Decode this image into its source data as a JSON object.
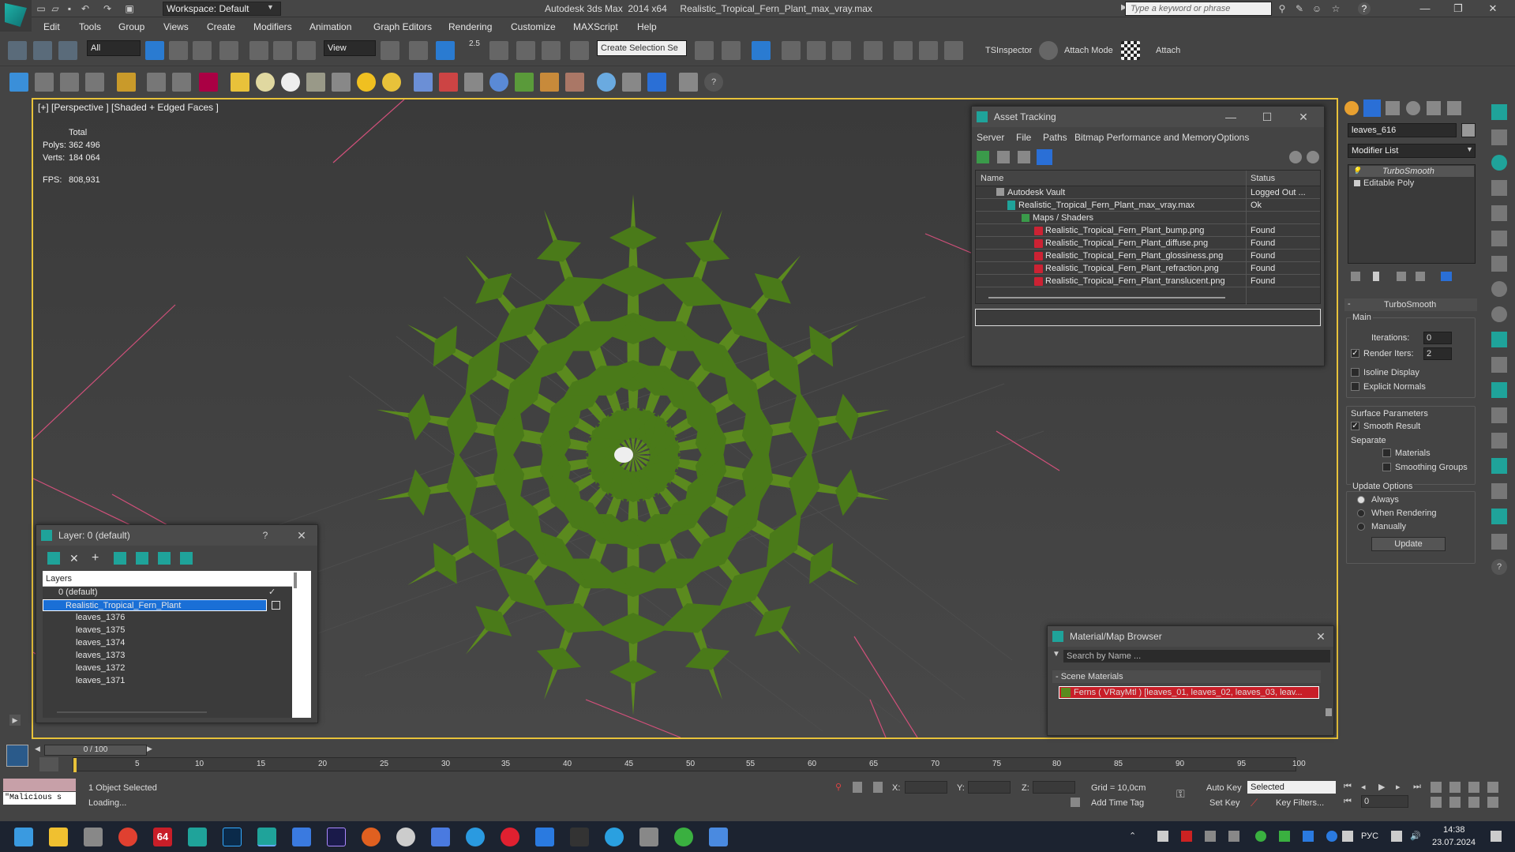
{
  "titlebar": {
    "workspace": "Workspace: Default",
    "title": "Autodesk 3ds Max  2014 x64     Realistic_Tropical_Fern_Plant_max_vray.max",
    "search_placeholder": "Type a keyword or phrase"
  },
  "menubar": [
    "Edit",
    "Tools",
    "Group",
    "Views",
    "Create",
    "Modifiers",
    "Animation",
    "Graph Editors",
    "Rendering",
    "Customize",
    "MAXScript",
    "Help"
  ],
  "toolbar": {
    "selection_filter": "All",
    "ref_coord": "View",
    "snap_value": "2.5",
    "named_selection": "Create Selection Se",
    "tsinspector": "TSInspector",
    "attach_mode": "Attach Mode",
    "attach": "Attach"
  },
  "viewport": {
    "label": "[+] [Perspective ] [Shaded + Edged Faces ]",
    "stats_header": "Total",
    "polys_label": "Polys:",
    "polys_value": "362 496",
    "verts_label": "Verts:",
    "verts_value": "184 064",
    "fps_label": "FPS:",
    "fps_value": "808,931"
  },
  "asset_tracking": {
    "title": "Asset Tracking",
    "menu": [
      "Server",
      "File",
      "Paths",
      "Bitmap Performance and Memory",
      "Options"
    ],
    "col_name": "Name",
    "col_status": "Status",
    "rows": [
      {
        "name": "Autodesk Vault",
        "status": "Logged Out ..."
      },
      {
        "name": "Realistic_Tropical_Fern_Plant_max_vray.max",
        "status": "Ok"
      },
      {
        "name": "Maps / Shaders",
        "status": ""
      },
      {
        "name": "Realistic_Tropical_Fern_Plant_bump.png",
        "status": "Found"
      },
      {
        "name": "Realistic_Tropical_Fern_Plant_diffuse.png",
        "status": "Found"
      },
      {
        "name": "Realistic_Tropical_Fern_Plant_glossiness.png",
        "status": "Found"
      },
      {
        "name": "Realistic_Tropical_Fern_Plant_refraction.png",
        "status": "Found"
      },
      {
        "name": "Realistic_Tropical_Fern_Plant_translucent.png",
        "status": "Found"
      }
    ]
  },
  "command_panel": {
    "object_name": "leaves_616",
    "modifier_list": "Modifier List",
    "stack": [
      "TurboSmooth",
      "Editable Poly"
    ],
    "rollout_title": "TurboSmooth",
    "main_label": "Main",
    "iterations_label": "Iterations:",
    "iterations_value": "0",
    "render_iters_label": "Render Iters:",
    "render_iters_value": "2",
    "isoline": "Isoline Display",
    "explicit_normals": "Explicit Normals",
    "surface_params": "Surface Parameters",
    "smooth_result": "Smooth Result",
    "separate": "Separate",
    "materials": "Materials",
    "smoothing_groups": "Smoothing Groups",
    "update_options": "Update Options",
    "always": "Always",
    "when_rendering": "When Rendering",
    "manually": "Manually",
    "update_btn": "Update"
  },
  "layer_panel": {
    "title": "Layer: 0 (default)",
    "help": "?",
    "header": "Layers",
    "rows": [
      "0 (default)",
      "Realistic_Tropical_Fern_Plant",
      "leaves_1376",
      "leaves_1375",
      "leaves_1374",
      "leaves_1373",
      "leaves_1372",
      "leaves_1371"
    ]
  },
  "material_browser": {
    "title": "Material/Map Browser",
    "search_placeholder": "Search by Name ...",
    "section": "- Scene Materials",
    "item": "Ferns  ( VRayMtl )  [leaves_01, leaves_02, leaves_03, leav..."
  },
  "timeline": {
    "frame": "0 / 100",
    "ticks": [
      "5",
      "10",
      "15",
      "20",
      "25",
      "30",
      "35",
      "40",
      "45",
      "50",
      "55",
      "60",
      "65",
      "70",
      "75",
      "80",
      "85",
      "90",
      "95",
      "100"
    ]
  },
  "status": {
    "script_listener": "\"Malicious s",
    "selected": "1 Object Selected",
    "loading": "Loading...",
    "x": "X:",
    "y": "Y:",
    "z": "Z:",
    "grid": "Grid = 10,0cm",
    "add_time_tag": "Add Time Tag",
    "auto_key": "Auto Key",
    "set_key": "Set Key",
    "selected_dropdown": "Selected",
    "key_filters": "Key Filters...",
    "frame_field": "0"
  },
  "taskbar": {
    "lang": "РУС",
    "time": "14:38",
    "date": "23.07.2024",
    "badge": "64"
  },
  "colors": {
    "accent_yellow": "#e8c23a",
    "selection_blue": "#1a6fd6",
    "fern_green": "#5b8a1e",
    "red_highlight": "#c81e28"
  }
}
